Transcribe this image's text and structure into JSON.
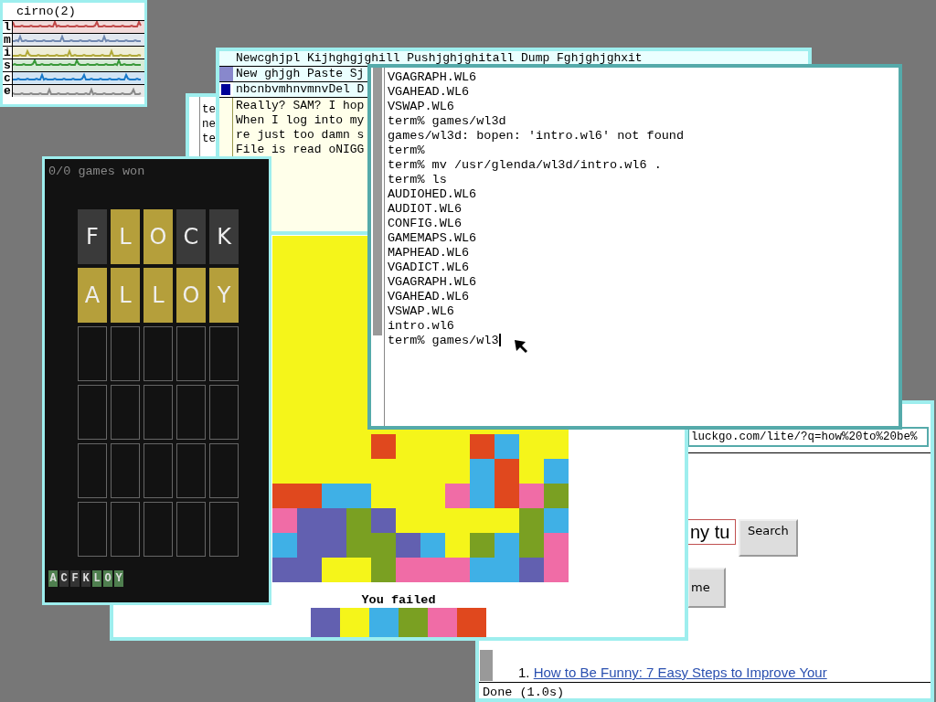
{
  "stats_window": {
    "title": "cirno(2)",
    "rows": [
      {
        "label": "l",
        "color": "#c04848"
      },
      {
        "label": "m",
        "color": "#7088b0"
      },
      {
        "label": "i",
        "color": "#b0a838"
      },
      {
        "label": "s",
        "color": "#389838"
      },
      {
        "label": "c",
        "color": "#1878c8"
      },
      {
        "label": "e",
        "color": "#888888"
      }
    ]
  },
  "back_window": {
    "lines": [
      "te",
      "ne",
      "te"
    ]
  },
  "acme_window": {
    "tag_lines": [
      "Newcghjpl Kijhghgjghill Pushjghjghitall Dump Fghjghjghxit",
      "New ghjgh Paste Sj",
      "nbcnbvmhnvmnvDel D"
    ],
    "body_lines": [
      "Really? SAM? I hop",
      "When I log into my",
      "re just too damn s",
      "File is read oNIGG"
    ]
  },
  "browser_window": {
    "url": "luckgo.com/lite/?q=how%20to%20be%",
    "search_value": "ny tu",
    "search_button": "Search",
    "second_button": "me",
    "result_number": "1.",
    "result_link": "How to Be Funny: 7 Easy Steps to Improve Your",
    "status": "Done (1.0s)"
  },
  "tetris_window": {
    "field": {
      "color": "#f5f51a"
    },
    "board": [
      {
        "cells": [
          {
            "color": "#f5f51a"
          },
          {
            "color": "#f5f51a"
          },
          {
            "color": "#f5f51a"
          },
          {
            "color": "#f5f51a"
          },
          {
            "color": "#e0481e"
          },
          {
            "color": "#f5f51a"
          },
          {
            "color": "#f5f51a"
          },
          {
            "color": "#f5f51a"
          },
          {
            "color": "#e0481e"
          },
          {
            "color": "#3fb0e6"
          },
          {
            "color": "#f5f51a"
          },
          {
            "color": "#f5f51a"
          }
        ]
      },
      {
        "cells": [
          {
            "color": "#f5f51a"
          },
          {
            "color": "#f5f51a"
          },
          {
            "color": "#f5f51a"
          },
          {
            "color": "#f5f51a"
          },
          {
            "color": "#f5f51a"
          },
          {
            "color": "#f5f51a"
          },
          {
            "color": "#f5f51a"
          },
          {
            "color": "#f5f51a"
          },
          {
            "color": "#3fb0e6"
          },
          {
            "color": "#e0481e"
          },
          {
            "color": "#f5f51a"
          },
          {
            "color": "#3fb0e6"
          }
        ]
      },
      {
        "cells": [
          {
            "color": "#e0481e"
          },
          {
            "color": "#e0481e"
          },
          {
            "color": "#3fb0e6"
          },
          {
            "color": "#3fb0e6"
          },
          {
            "color": "#f5f51a"
          },
          {
            "color": "#f5f51a"
          },
          {
            "color": "#f5f51a"
          },
          {
            "color": "#f06ca6"
          },
          {
            "color": "#3fb0e6"
          },
          {
            "color": "#e0481e"
          },
          {
            "color": "#f06ca6"
          },
          {
            "color": "#7aa022"
          }
        ]
      },
      {
        "cells": [
          {
            "color": "#f06ca6"
          },
          {
            "color": "#6260b0"
          },
          {
            "color": "#6260b0"
          },
          {
            "color": "#7aa022"
          },
          {
            "color": "#6260b0"
          },
          {
            "color": "#f5f51a"
          },
          {
            "color": "#f5f51a"
          },
          {
            "color": "#f5f51a"
          },
          {
            "color": "#f5f51a"
          },
          {
            "color": "#f5f51a"
          },
          {
            "color": "#7aa022"
          },
          {
            "color": "#3fb0e6"
          }
        ]
      },
      {
        "cells": [
          {
            "color": "#3fb0e6"
          },
          {
            "color": "#6260b0"
          },
          {
            "color": "#6260b0"
          },
          {
            "color": "#7aa022"
          },
          {
            "color": "#7aa022"
          },
          {
            "color": "#6260b0"
          },
          {
            "color": "#3fb0e6"
          },
          {
            "color": "#f5f51a"
          },
          {
            "color": "#7aa022"
          },
          {
            "color": "#3fb0e6"
          },
          {
            "color": "#7aa022"
          },
          {
            "color": "#f06ca6"
          }
        ]
      },
      {
        "cells": [
          {
            "color": "#6260b0"
          },
          {
            "color": "#6260b0"
          },
          {
            "color": "#f5f51a"
          },
          {
            "color": "#f5f51a"
          },
          {
            "color": "#7aa022"
          },
          {
            "color": "#f06ca6"
          },
          {
            "color": "#f06ca6"
          },
          {
            "color": "#f06ca6"
          },
          {
            "color": "#3fb0e6"
          },
          {
            "color": "#3fb0e6"
          },
          {
            "color": "#6260b0"
          },
          {
            "color": "#f06ca6"
          }
        ]
      }
    ],
    "message": "You failed",
    "next_colors": [
      {
        "color": "#6260b0"
      },
      {
        "color": "#f5f51a"
      },
      {
        "color": "#3fb0e6"
      },
      {
        "color": "#7aa022"
      },
      {
        "color": "#f06ca6"
      },
      {
        "color": "#e0481e"
      }
    ]
  },
  "wordle_window": {
    "score": "0/0 games won",
    "rows": [
      {
        "tiles": [
          {
            "letter": "F",
            "kind": "absent"
          },
          {
            "letter": "L",
            "kind": "present"
          },
          {
            "letter": "O",
            "kind": "present"
          },
          {
            "letter": "C",
            "kind": "absent"
          },
          {
            "letter": "K",
            "kind": "absent"
          }
        ]
      },
      {
        "tiles": [
          {
            "letter": "A",
            "kind": "present"
          },
          {
            "letter": "L",
            "kind": "present"
          },
          {
            "letter": "L",
            "kind": "present"
          },
          {
            "letter": "O",
            "kind": "present"
          },
          {
            "letter": "Y",
            "kind": "present"
          }
        ]
      },
      {
        "tiles": [
          {
            "kind": "empty"
          },
          {
            "kind": "empty"
          },
          {
            "kind": "empty"
          },
          {
            "kind": "empty"
          },
          {
            "kind": "empty"
          }
        ]
      },
      {
        "tiles": [
          {
            "kind": "empty"
          },
          {
            "kind": "empty"
          },
          {
            "kind": "empty"
          },
          {
            "kind": "empty"
          },
          {
            "kind": "empty"
          }
        ]
      },
      {
        "tiles": [
          {
            "kind": "empty"
          },
          {
            "kind": "empty"
          },
          {
            "kind": "empty"
          },
          {
            "kind": "empty"
          },
          {
            "kind": "empty"
          }
        ]
      },
      {
        "tiles": [
          {
            "kind": "empty"
          },
          {
            "kind": "empty"
          },
          {
            "kind": "empty"
          },
          {
            "kind": "empty"
          },
          {
            "kind": "empty"
          }
        ]
      }
    ],
    "letters": [
      {
        "letter": "A",
        "kind": "present"
      },
      {
        "letter": "C",
        "kind": "absent"
      },
      {
        "letter": "F",
        "kind": "absent"
      },
      {
        "letter": "K",
        "kind": "absent"
      },
      {
        "letter": "L",
        "kind": "present"
      },
      {
        "letter": "O",
        "kind": "present"
      },
      {
        "letter": "Y",
        "kind": "present"
      }
    ]
  },
  "term_window": {
    "lines": [
      "VGAGRAPH.WL6",
      "VGAHEAD.WL6",
      "VSWAP.WL6",
      "term% games/wl3d",
      "games/wl3d: bopen: 'intro.wl6' not found",
      "term%",
      "term% mv /usr/glenda/wl3d/intro.wl6 .",
      "term% ls",
      "AUDIOHED.WL6",
      "AUDIOT.WL6",
      "CONFIG.WL6",
      "GAMEMAPS.WL6",
      "MAPHEAD.WL6",
      "VGADICT.WL6",
      "VGAGRAPH.WL6",
      "VGAHEAD.WL6",
      "VSWAP.WL6",
      "intro.wl6",
      "term% games/wl3"
    ]
  }
}
